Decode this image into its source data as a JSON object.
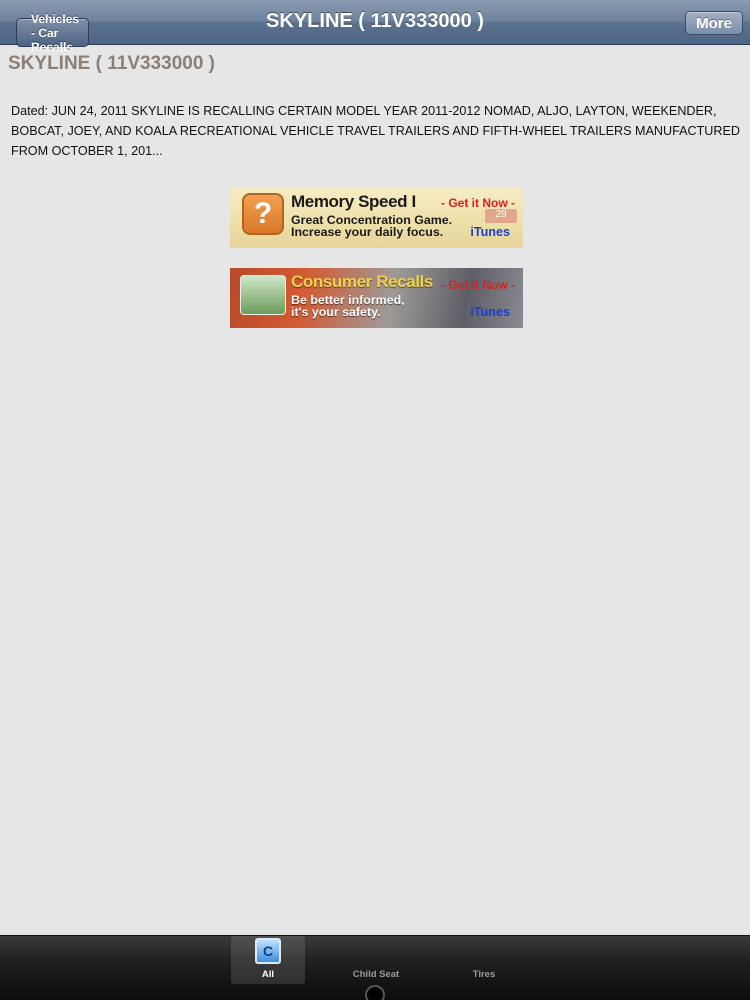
{
  "navbar": {
    "back_label": "Vehicles - Car Recalls",
    "title": "SKYLINE ( 11V333000 )",
    "more_label": "More"
  },
  "content": {
    "heading": "SKYLINE ( 11V333000 )",
    "recall_text": "Dated: JUN 24, 2011 SKYLINE IS RECALLING CERTAIN MODEL YEAR 2011-2012 NOMAD, ALJO, LAYTON, WEEKENDER, BOBCAT, JOEY, AND KOALA RECREATIONAL VEHICLE TRAVEL TRAILERS AND FIFTH-WHEEL TRAILERS MANUFACTURED FROM OCTOBER 1, 201..."
  },
  "ads": [
    {
      "title": "Memory Speed I",
      "get_it": "- Get it Now -",
      "line1": "Great Concentration Game.",
      "line2": "Increase your daily focus.",
      "store": "iTunes",
      "badge": "29",
      "icon": "question-mark-icon"
    },
    {
      "title": "Consumer Recalls",
      "get_it": "- Get it Now -",
      "line1": "Be better informed,",
      "line2": "it's your safety.",
      "store": "iTunes",
      "icon": "consumer-recalls-app-icon"
    }
  ],
  "tabbar": {
    "tabs": [
      {
        "label": "All",
        "icon": "all-recalls-icon",
        "selected": true
      },
      {
        "label": "Child Seat",
        "selected": false
      },
      {
        "label": "Tires",
        "selected": false
      }
    ]
  }
}
